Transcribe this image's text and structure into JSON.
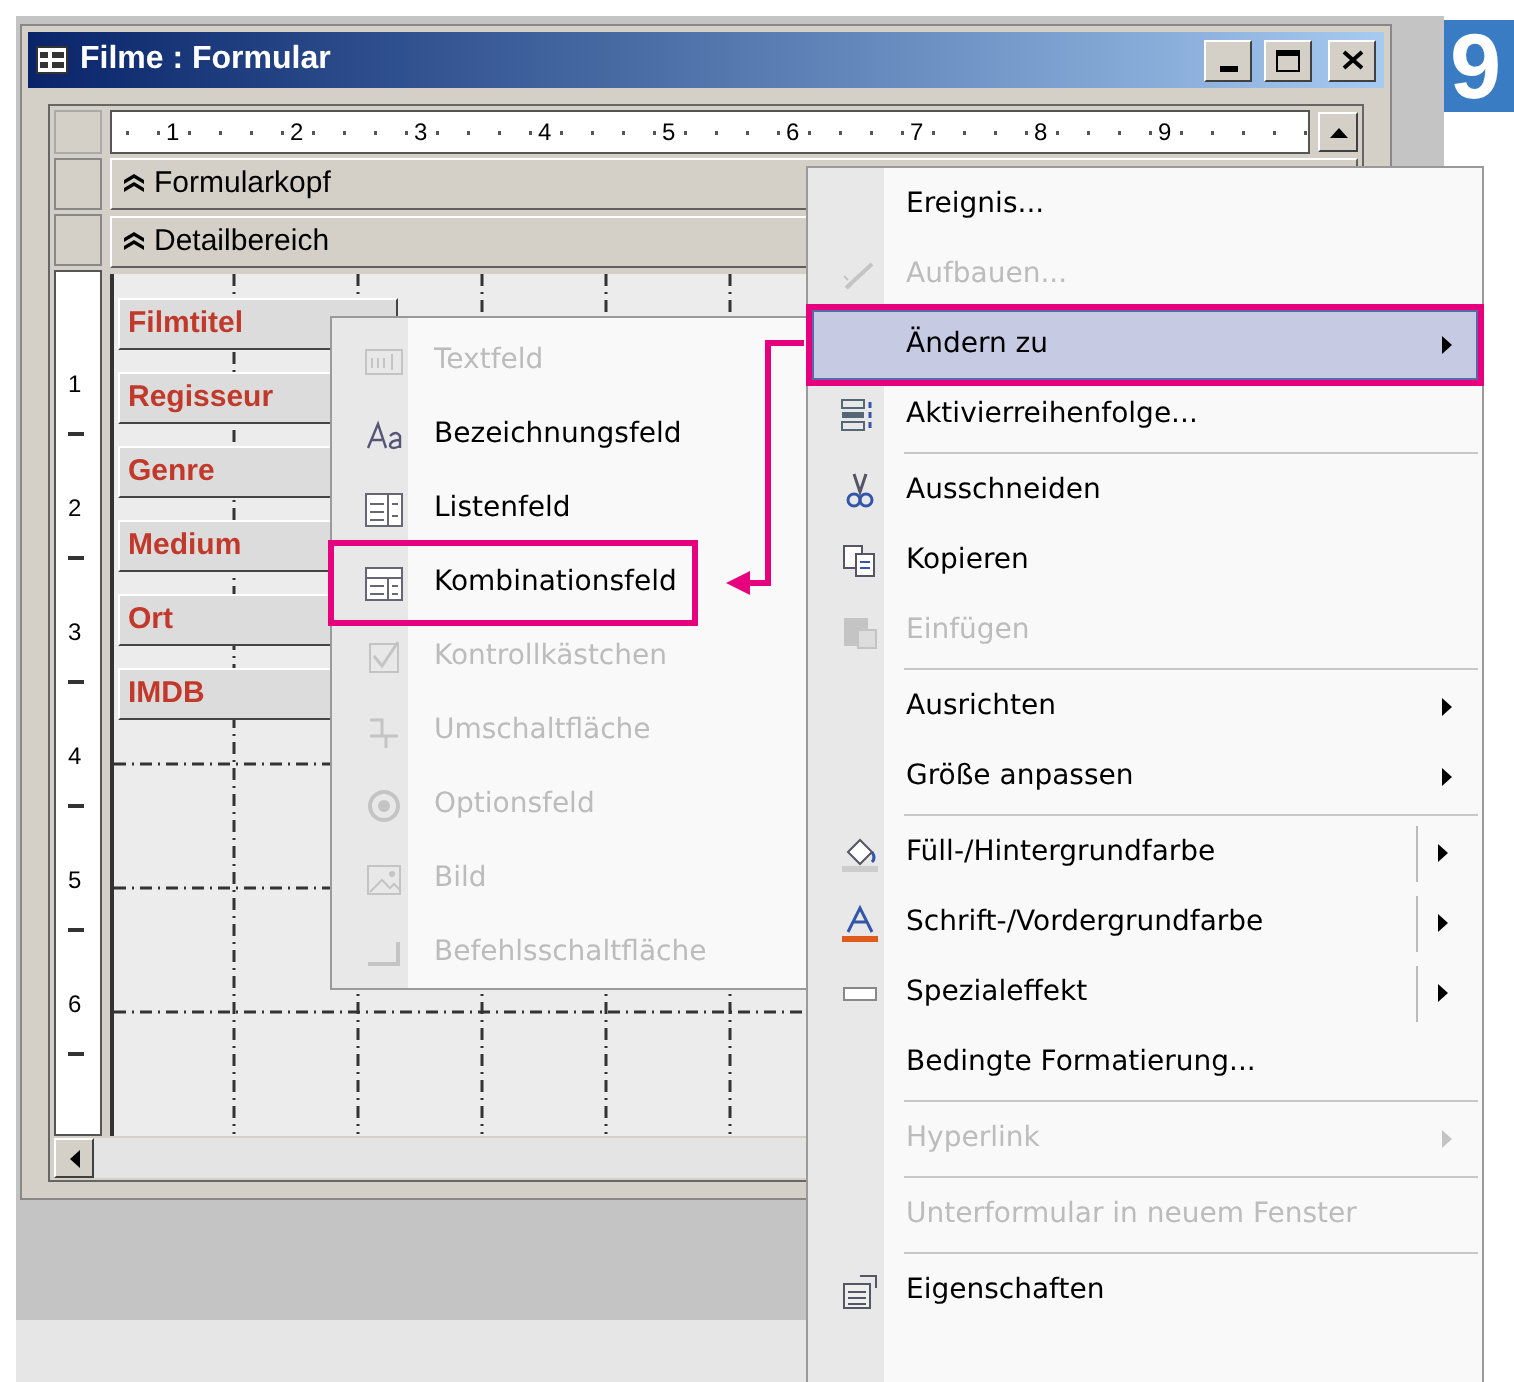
{
  "window": {
    "title": "Filme : Formular"
  },
  "step_badge": "9",
  "ruler": {
    "horizontal": [
      "1",
      "2",
      "3",
      "4",
      "5",
      "6",
      "7",
      "8",
      "9"
    ],
    "vertical": [
      "1",
      "2",
      "3",
      "4",
      "5",
      "6"
    ]
  },
  "sections": [
    {
      "label": "Formularkopf"
    },
    {
      "label": "Detailbereich"
    }
  ],
  "labels": [
    "Filmtitel",
    "Regisseur",
    "Genre",
    "Medium",
    "Ort",
    "IMDB"
  ],
  "context_menu": [
    {
      "kind": "plain",
      "label": "Ereignis...",
      "disabled": false,
      "selected": false,
      "annotated": false,
      "has_submenu": false,
      "split": false
    },
    {
      "kind": "build",
      "label": "Aufbauen...",
      "disabled": true,
      "selected": false,
      "annotated": false,
      "has_submenu": false,
      "split": false
    },
    {
      "kind": "plain",
      "label": "Ändern zu",
      "disabled": false,
      "selected": true,
      "annotated": true,
      "has_submenu": true,
      "split": false
    },
    {
      "kind": "taborder",
      "label": "Aktivierreihenfolge...",
      "disabled": false,
      "selected": false,
      "annotated": false,
      "has_submenu": false,
      "split": false
    },
    {
      "kind": "separator"
    },
    {
      "kind": "cut",
      "label": "Ausschneiden",
      "disabled": false,
      "selected": false,
      "annotated": false,
      "has_submenu": false,
      "split": false
    },
    {
      "kind": "copy",
      "label": "Kopieren",
      "disabled": false,
      "selected": false,
      "annotated": false,
      "has_submenu": false,
      "split": false
    },
    {
      "kind": "paste",
      "label": "Einfügen",
      "disabled": true,
      "selected": false,
      "annotated": false,
      "has_submenu": false,
      "split": false
    },
    {
      "kind": "separator"
    },
    {
      "kind": "plain",
      "label": "Ausrichten",
      "disabled": false,
      "selected": false,
      "annotated": false,
      "has_submenu": true,
      "split": false
    },
    {
      "kind": "plain",
      "label": "Größe anpassen",
      "disabled": false,
      "selected": false,
      "annotated": false,
      "has_submenu": true,
      "split": false
    },
    {
      "kind": "separator"
    },
    {
      "kind": "fill",
      "label": "Füll-/Hintergrundfarbe",
      "disabled": false,
      "selected": false,
      "annotated": false,
      "has_submenu": true,
      "split": true
    },
    {
      "kind": "fontcolor",
      "label": "Schrift-/Vordergrundfarbe",
      "disabled": false,
      "selected": false,
      "annotated": false,
      "has_submenu": true,
      "split": true
    },
    {
      "kind": "effect",
      "label": "Spezialeffekt",
      "disabled": false,
      "selected": false,
      "annotated": false,
      "has_submenu": true,
      "split": true
    },
    {
      "kind": "plain",
      "label": "Bedingte Formatierung...",
      "disabled": false,
      "selected": false,
      "annotated": false,
      "has_submenu": false,
      "split": false
    },
    {
      "kind": "separator"
    },
    {
      "kind": "plain",
      "label": "Hyperlink",
      "disabled": true,
      "selected": false,
      "annotated": false,
      "has_submenu": true,
      "split": false
    },
    {
      "kind": "separator"
    },
    {
      "kind": "plain",
      "label": "Unterformular in neuem Fenster",
      "disabled": true,
      "selected": false,
      "annotated": false,
      "has_submenu": false,
      "split": false
    },
    {
      "kind": "separator"
    },
    {
      "kind": "properties",
      "label": "Eigenschaften",
      "disabled": false,
      "selected": false,
      "annotated": false,
      "has_submenu": false,
      "split": false
    }
  ],
  "submenu": [
    {
      "label": "Textfeld",
      "kind": "textbox",
      "disabled": true,
      "annotated": false
    },
    {
      "label": "Bezeichnungsfeld",
      "kind": "label",
      "disabled": false,
      "annotated": false
    },
    {
      "label": "Listenfeld",
      "kind": "listbox",
      "disabled": false,
      "annotated": false
    },
    {
      "label": "Kombinationsfeld",
      "kind": "combobox",
      "disabled": false,
      "annotated": true
    },
    {
      "label": "Kontrollkästchen",
      "kind": "checkbox",
      "disabled": true,
      "annotated": false
    },
    {
      "label": "Umschaltfläche",
      "kind": "toggle",
      "disabled": true,
      "annotated": false
    },
    {
      "label": "Optionsfeld",
      "kind": "radio",
      "disabled": true,
      "annotated": false
    },
    {
      "label": "Bild",
      "kind": "image",
      "disabled": true,
      "annotated": false
    },
    {
      "label": "Befehlsschaltfläche",
      "kind": "button",
      "disabled": true,
      "annotated": false
    }
  ]
}
